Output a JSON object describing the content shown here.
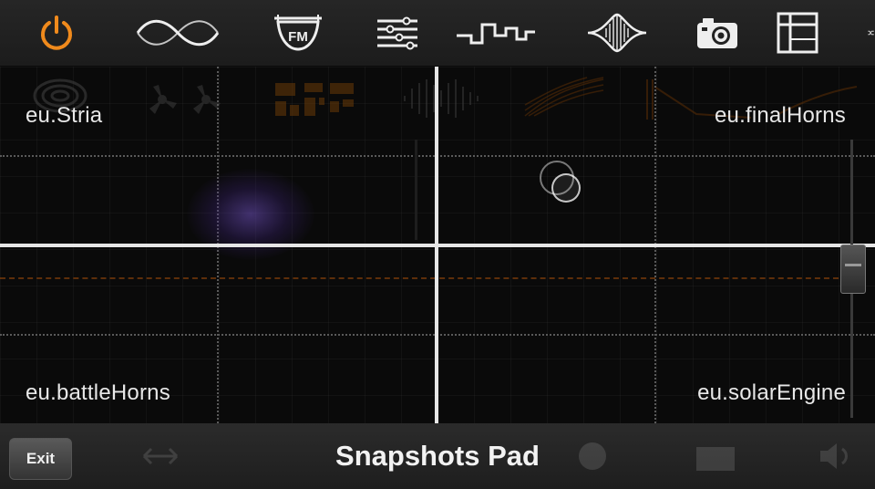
{
  "toolbar": {
    "icons": [
      {
        "name": "power-icon",
        "color": "#f08a1c"
      },
      {
        "name": "sine-wave-icon"
      },
      {
        "name": "fm-module-icon",
        "label": "FM"
      },
      {
        "name": "mixer-sliders-icon"
      },
      {
        "name": "square-wave-icon"
      },
      {
        "name": "waveform-envelope-icon"
      },
      {
        "name": "camera-icon"
      },
      {
        "name": "grid-layout-icon"
      },
      {
        "name": "shuffle-icon"
      }
    ]
  },
  "pad": {
    "corners": {
      "top_left": "eu.Stria",
      "top_right": "eu.finalHorns",
      "bottom_left": "eu.battleHorns",
      "bottom_right": "eu.solarEngine"
    },
    "colors": {
      "accent": "#f08a1c",
      "axis": "#e6e6e6",
      "glow": "#6e50be"
    }
  },
  "bottom_bar": {
    "exit_label": "Exit",
    "title": "Snapshots Pad"
  }
}
